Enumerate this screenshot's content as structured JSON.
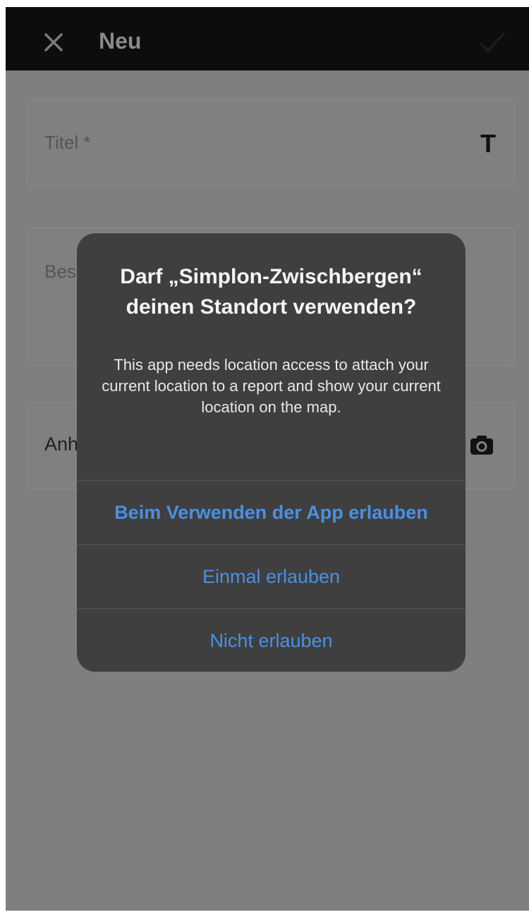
{
  "header": {
    "title": "Neu",
    "close_icon": "close-icon",
    "confirm_icon": "checkmark-icon"
  },
  "form": {
    "title_label": "Titel *",
    "title_icon": "T",
    "description_label": "Bes",
    "attachments_label": "Anh",
    "attachments_icon": "camera-icon"
  },
  "dialog": {
    "title": "Darf „Simplon-Zwischbergen“ deinen Standort verwenden?",
    "message": "This app needs location access to attach your current location to a report and show your current location on the map.",
    "buttons": [
      {
        "label": "Beim Verwenden der App erlauben"
      },
      {
        "label": "Einmal erlauben"
      },
      {
        "label": "Nicht erlauben"
      }
    ]
  },
  "colors": {
    "overlay": "#7f7f7f",
    "topbar": "#0d0d0d",
    "dialog_bg": "#3f3f3f",
    "action_blue": "#4a90e2"
  }
}
